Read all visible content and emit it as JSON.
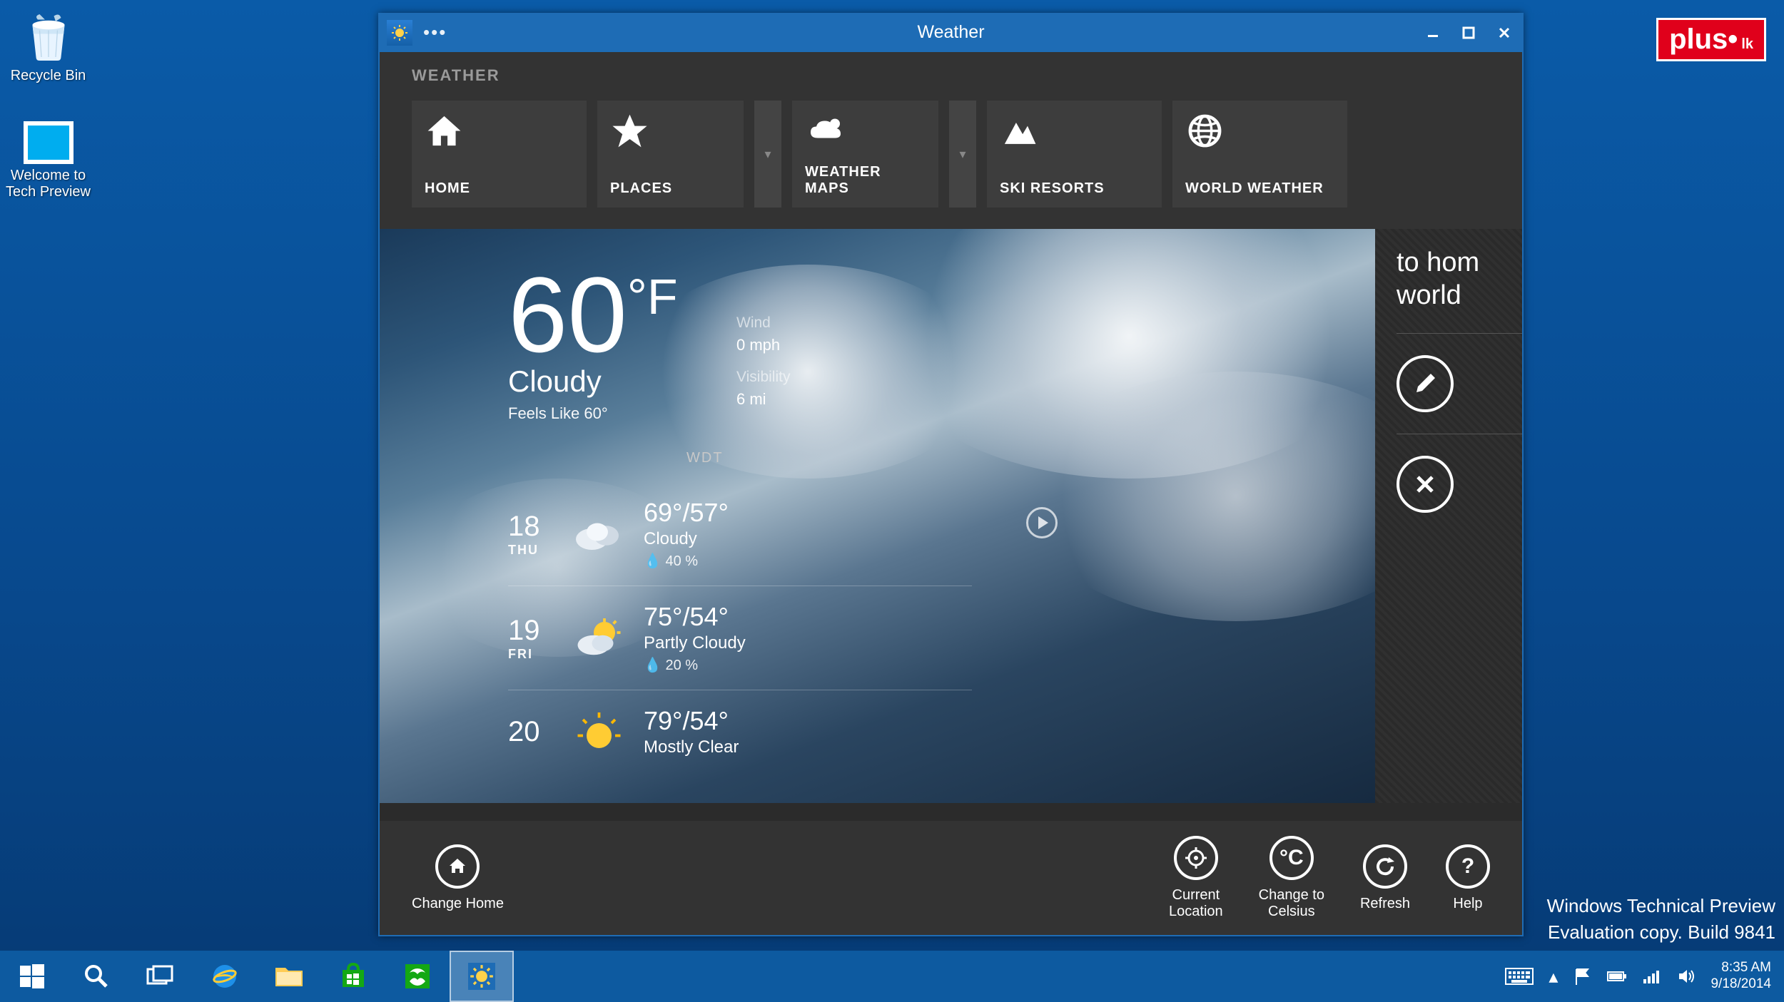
{
  "desktop": {
    "recycle_bin": "Recycle Bin",
    "tech_preview": "Welcome to\nTech Preview"
  },
  "window": {
    "title": "Weather",
    "nav_label": "WEATHER",
    "tiles": [
      {
        "label": "HOME",
        "icon": "home"
      },
      {
        "label": "PLACES",
        "icon": "star",
        "dropdown": true
      },
      {
        "label": "WEATHER MAPS",
        "icon": "clouds",
        "dropdown": true
      },
      {
        "label": "SKI RESORTS",
        "icon": "mountain"
      },
      {
        "label": "WORLD WEATHER",
        "icon": "globe"
      }
    ]
  },
  "current": {
    "temp": "60",
    "unit": "°F",
    "condition": "Cloudy",
    "feels_like": "Feels Like 60°",
    "wind_label": "Wind",
    "wind": "0 mph",
    "visibility_label": "Visibility",
    "visibility": "6 mi",
    "provider": "WDT"
  },
  "forecast": [
    {
      "date": "18",
      "dow": "THU",
      "hilo": "69°/57°",
      "desc": "Cloudy",
      "precip": "40 %",
      "icon": "cloudy"
    },
    {
      "date": "19",
      "dow": "FRI",
      "hilo": "75°/54°",
      "desc": "Partly Cloudy",
      "precip": "20 %",
      "icon": "partly"
    },
    {
      "date": "20",
      "dow": "",
      "hilo": "79°/54°",
      "desc": "Mostly Clear",
      "precip": "",
      "icon": "sunny"
    }
  ],
  "sidebar_hint": {
    "line1": "to hom",
    "line2": "world"
  },
  "bottom_bar": {
    "change_home": "Change Home",
    "current_location": "Current\nLocation",
    "change_celsius": "Change to\nCelsius",
    "refresh": "Refresh",
    "help": "Help"
  },
  "watermark": {
    "line1": "Windows Technical Preview",
    "line2": "Evaluation copy. Build 9841"
  },
  "tray": {
    "time": "8:35 AM",
    "date": "9/18/2014"
  },
  "logo": {
    "plus": "plus",
    "lk": "lk"
  }
}
